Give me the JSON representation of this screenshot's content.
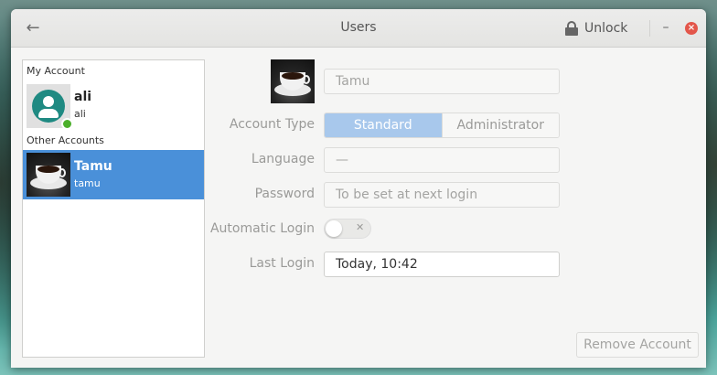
{
  "window": {
    "title": "Users",
    "unlock_label": "Unlock",
    "minimize_glyph": "–",
    "close_glyph": "×",
    "back_glyph": "←"
  },
  "icons": {
    "back": "back-arrow-icon",
    "lock": "lock-icon",
    "minimize": "minimize-icon",
    "close": "close-icon",
    "toggle_off": "toggle-x-icon"
  },
  "sidebar": {
    "my_account_label": "My Account",
    "other_accounts_label": "Other Accounts",
    "my_account": {
      "name": "ali",
      "login": "ali"
    },
    "other_accounts": [
      {
        "name": "Tamu",
        "login": "tamu",
        "selected": true
      }
    ]
  },
  "details": {
    "full_name_placeholder": "Tamu",
    "account_type_label": "Account Type",
    "account_types": [
      "Standard",
      "Administrator"
    ],
    "account_type_selected": "Standard",
    "language_label": "Language",
    "language_value": "—",
    "password_label": "Password",
    "password_value": "To be set at next login",
    "auto_login_label": "Automatic Login",
    "auto_login_enabled": false,
    "toggle_glyph": "✕",
    "last_login_label": "Last Login",
    "last_login_value": "Today, 10:42",
    "remove_button": "Remove Account"
  },
  "colors": {
    "selection": "#4a90d9",
    "avatar_accent": "#1f8a82",
    "online": "#4caf2b",
    "close": "#e3564a"
  }
}
